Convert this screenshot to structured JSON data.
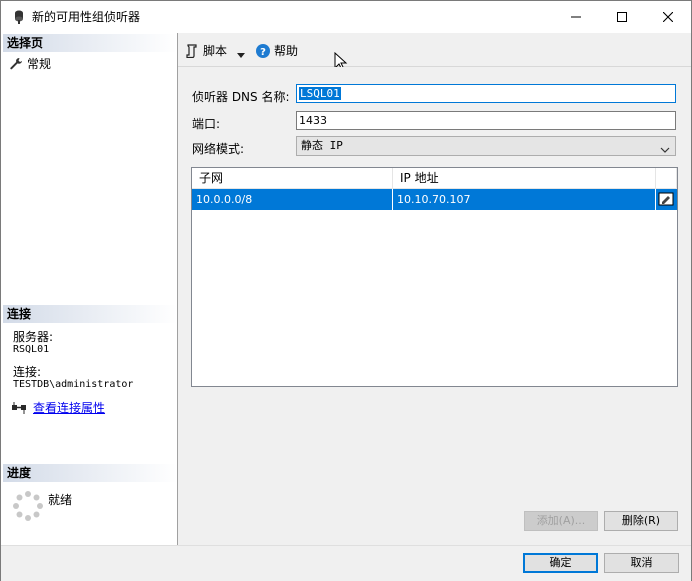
{
  "window": {
    "title": "新的可用性组侦听器"
  },
  "left_panel": {
    "select_page_header": "选择页",
    "pages": [
      {
        "label": "常规"
      }
    ],
    "connection_header": "连接",
    "server_label": "服务器:",
    "server_value": "RSQL01",
    "connection_label": "连接:",
    "connection_value": "TESTDB\\administrator",
    "view_connection_link": "查看连接属性",
    "progress_header": "进度",
    "progress_status": "就绪"
  },
  "toolbar": {
    "script_label": "脚本",
    "help_label": "帮助"
  },
  "form": {
    "dns_label": "侦听器 DNS 名称:",
    "dns_value": "LSQL01",
    "port_label": "端口:",
    "port_value": "1433",
    "network_mode_label": "网络模式:",
    "network_mode_value": "静态 IP"
  },
  "grid": {
    "columns": [
      "子网",
      "IP 地址"
    ],
    "rows": [
      {
        "subnet": "10.0.0.0/8",
        "ip": "10.10.70.107"
      }
    ]
  },
  "buttons": {
    "add": "添加(A)...",
    "remove": "删除(R)",
    "ok": "确定",
    "cancel": "取消"
  }
}
